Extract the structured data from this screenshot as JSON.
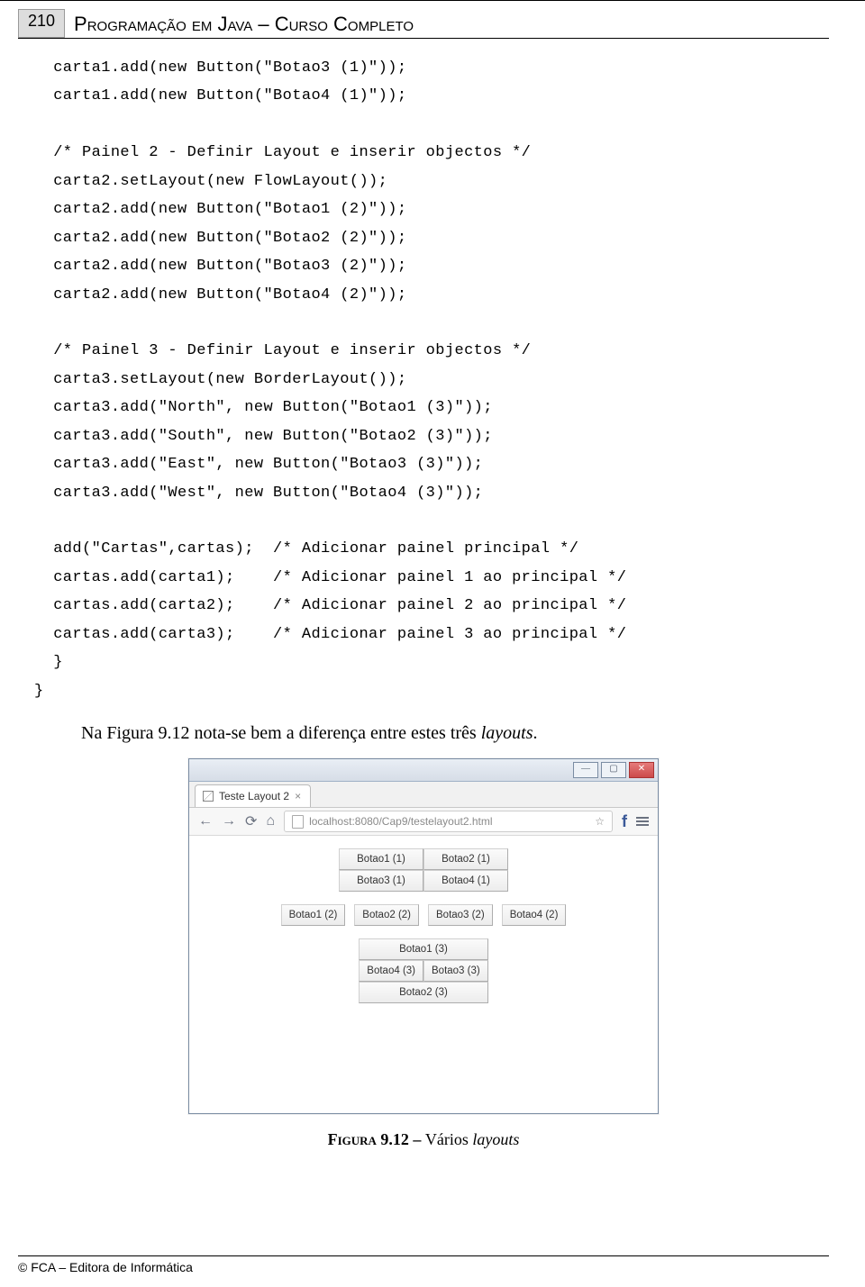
{
  "header": {
    "page_number": "210",
    "book_title": "Programação em Java – Curso Completo"
  },
  "code": "  carta1.add(new Button(\"Botao3 (1)\"));\n  carta1.add(new Button(\"Botao4 (1)\"));\n\n  /* Painel 2 - Definir Layout e inserir objectos */\n  carta2.setLayout(new FlowLayout());\n  carta2.add(new Button(\"Botao1 (2)\"));\n  carta2.add(new Button(\"Botao2 (2)\"));\n  carta2.add(new Button(\"Botao3 (2)\"));\n  carta2.add(new Button(\"Botao4 (2)\"));\n\n  /* Painel 3 - Definir Layout e inserir objectos */\n  carta3.setLayout(new BorderLayout());\n  carta3.add(\"North\", new Button(\"Botao1 (3)\"));\n  carta3.add(\"South\", new Button(\"Botao2 (3)\"));\n  carta3.add(\"East\", new Button(\"Botao3 (3)\"));\n  carta3.add(\"West\", new Button(\"Botao4 (3)\"));\n\n  add(\"Cartas\",cartas);  /* Adicionar painel principal */\n  cartas.add(carta1);    /* Adicionar painel 1 ao principal */\n  cartas.add(carta2);    /* Adicionar painel 2 ao principal */\n  cartas.add(carta3);    /* Adicionar painel 3 ao principal */\n  }\n}",
  "paragraph": {
    "pre": "Na Figura 9.12 nota-se bem a diferença entre estes três ",
    "italic": "layouts",
    "post": "."
  },
  "figure": {
    "window": {
      "tab_title": "Teste Layout 2",
      "tab_close": "×",
      "nav_back": "←",
      "nav_fwd": "→",
      "nav_reload": "⟳",
      "nav_home": "⌂",
      "url": "localhost:8080/Cap9/testelayout2.html",
      "star": "☆",
      "fb": "f",
      "menu": "≡",
      "min": "—",
      "max": "▢",
      "close": "✕"
    },
    "panel1": [
      "Botao1 (1)",
      "Botao2 (1)",
      "Botao3 (1)",
      "Botao4 (1)"
    ],
    "panel2": [
      "Botao1 (2)",
      "Botao2 (2)",
      "Botao3 (2)",
      "Botao4 (2)"
    ],
    "panel3": {
      "north": "Botao1 (3)",
      "west": "Botao4 (3)",
      "east": "Botao3 (3)",
      "south": "Botao2 (3)"
    }
  },
  "caption": {
    "label": "Figura 9.12 – ",
    "text": "Vários ",
    "italic": "layouts"
  },
  "footer": "© FCA – Editora de Informática"
}
